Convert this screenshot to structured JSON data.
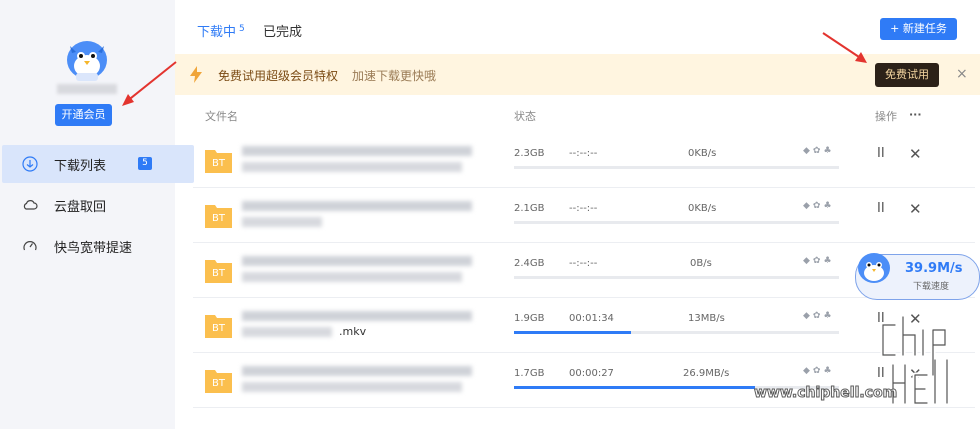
{
  "sidebar": {
    "vip_button": "开通会员",
    "nav": [
      {
        "label": "下载列表",
        "badge": "5"
      },
      {
        "label": "云盘取回"
      },
      {
        "label": "快鸟宽带提速"
      }
    ]
  },
  "tabs": {
    "downloading": "下载中",
    "downloading_count": "5",
    "completed": "已完成"
  },
  "new_task_label": "+ 新建任务",
  "banner": {
    "title": "免费试用超级会员特权",
    "subtitle": "加速下载更快哦",
    "trial_button": "免费试用",
    "close": "×"
  },
  "columns": {
    "filename": "文件名",
    "status": "状态",
    "actions": "操作",
    "more": "···"
  },
  "file_type_label": "BT",
  "pause_symbol": "II",
  "close_symbol": "✕",
  "rows": [
    {
      "size": "2.3GB",
      "time": "--:--:--",
      "speed": "0KB/s",
      "progress": 0
    },
    {
      "size": "2.1GB",
      "time": "--:--:--",
      "speed": "0KB/s",
      "progress": 0
    },
    {
      "size": "2.4GB",
      "time": "--:--:--",
      "speed": "0B/s",
      "progress": 0
    },
    {
      "size": "1.9GB",
      "time": "00:01:34",
      "speed": "13MB/s",
      "progress": 0.36,
      "name_fragment": ".mkv"
    },
    {
      "size": "1.7GB",
      "time": "00:00:27",
      "speed": "26.9MB/s",
      "progress": 0.74
    }
  ],
  "speed_widget": {
    "value": "39.9M/s",
    "label": "下载速度"
  },
  "watermark": "www.chiphell.com",
  "colors": {
    "accent": "#2f7bf6",
    "banner_bg": "#fff5e0",
    "trial_btn": "#2c2118",
    "folder": "#fbbf4e",
    "annotation_arrow": "#e3342f"
  }
}
